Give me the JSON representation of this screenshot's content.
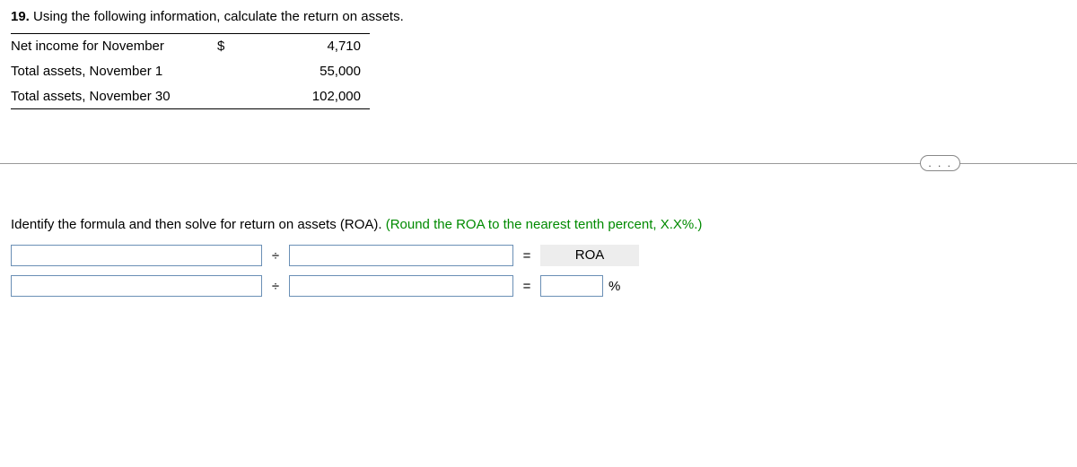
{
  "question": {
    "number": "19.",
    "text": "Using the following information, calculate the return on assets."
  },
  "table": {
    "rows": [
      {
        "label": "Net income for November",
        "currency": "$",
        "value": "4,710"
      },
      {
        "label": "Total assets, November 1",
        "currency": "",
        "value": "55,000"
      },
      {
        "label": "Total assets, November 30",
        "currency": "",
        "value": "102,000"
      }
    ]
  },
  "ellipsis": ". . .",
  "instruction": {
    "plain": "Identify the formula and then solve for return on assets (ROA). ",
    "hint": "(Round the ROA to the nearest tenth percent, X.X%.)"
  },
  "ops": {
    "div": "÷",
    "eq": "="
  },
  "labels": {
    "roa": "ROA",
    "pct": "%"
  },
  "inputs": {
    "f1": "",
    "f2": "",
    "v1": "",
    "v2": "",
    "res": ""
  }
}
